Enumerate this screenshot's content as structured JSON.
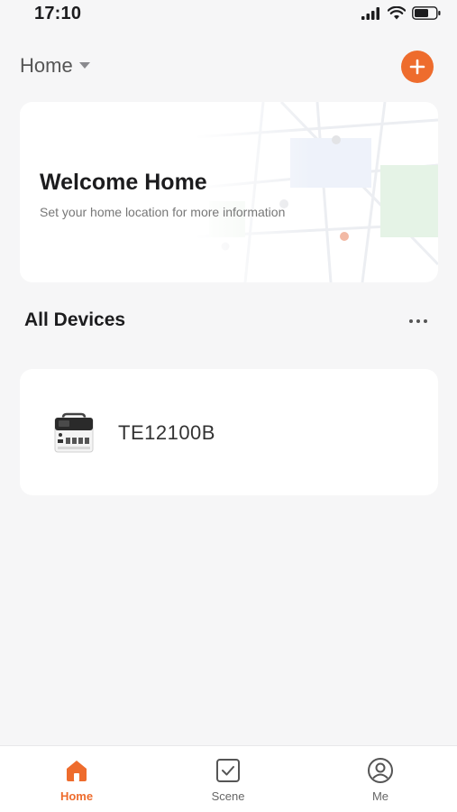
{
  "status_bar": {
    "time": "17:10"
  },
  "header": {
    "home_name": "Home"
  },
  "welcome": {
    "title": "Welcome Home",
    "subtitle": "Set your home location for more information"
  },
  "devices_section": {
    "title": "All Devices"
  },
  "devices": [
    {
      "name": "TE12100B"
    }
  ],
  "tabs": [
    {
      "label": "Home",
      "active": true
    },
    {
      "label": "Scene",
      "active": false
    },
    {
      "label": "Me",
      "active": false
    }
  ],
  "colors": {
    "accent": "#ee6c2d",
    "background": "#f6f6f7",
    "card": "#ffffff"
  }
}
